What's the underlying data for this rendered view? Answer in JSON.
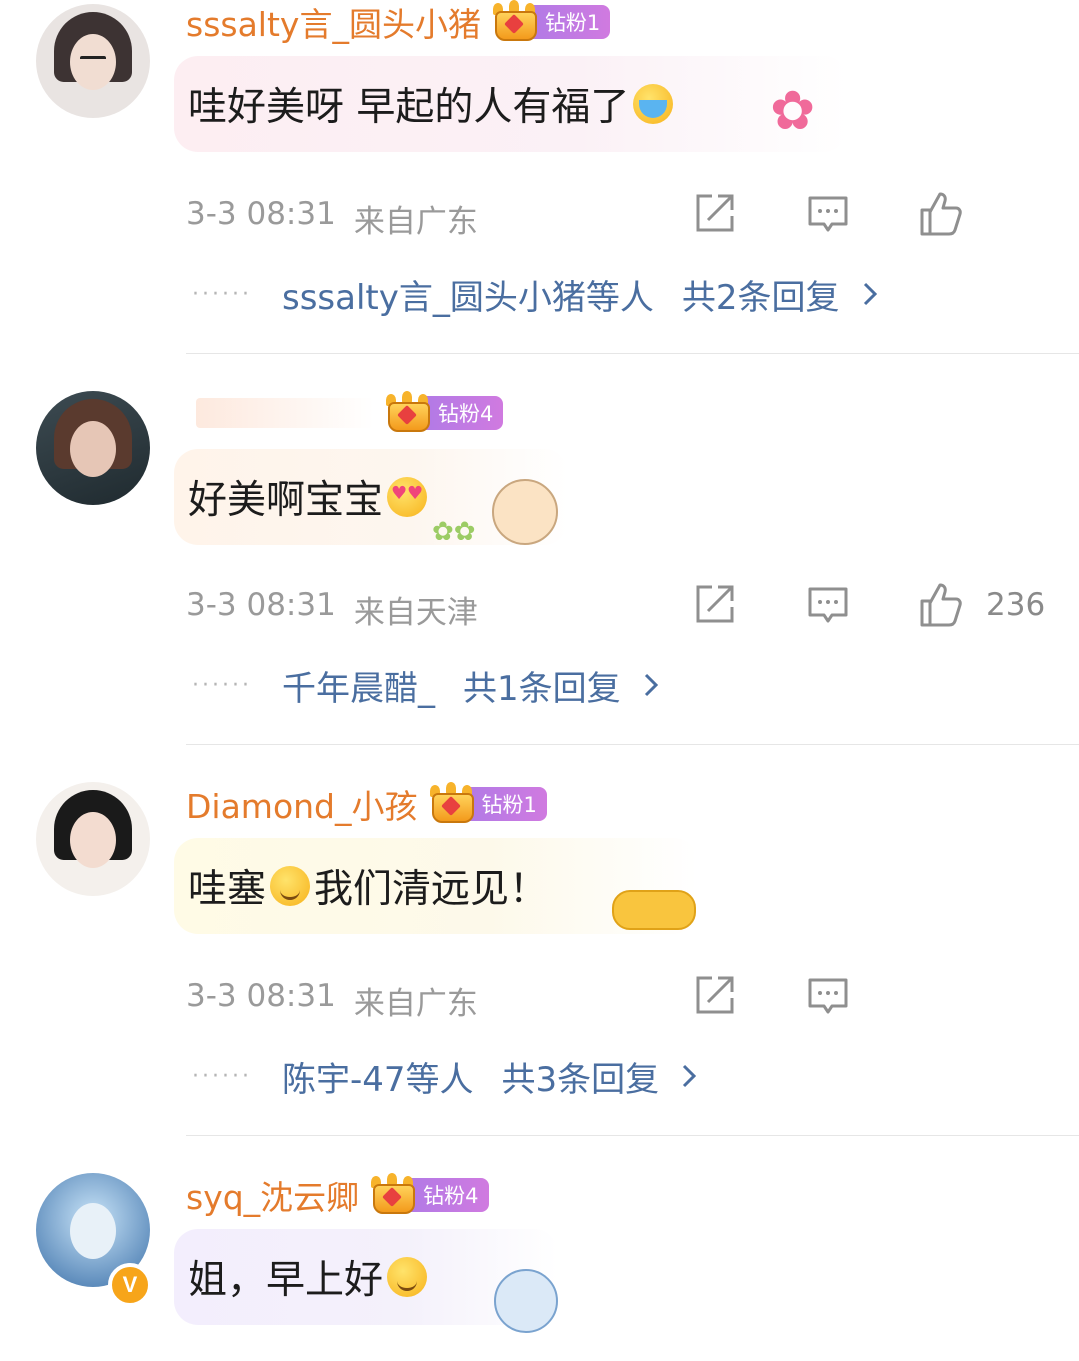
{
  "comments": [
    {
      "username": "sssalty言_圆头小猪",
      "fan_badge": "钻粉1",
      "text": "哇好美呀 早起的人有福了",
      "emoji": "loudly-crying-emoji",
      "time": "3-3 08:31",
      "location": "来自广东",
      "like_count": "",
      "reply_names": "sssalty言_圆头小猪等人",
      "reply_count": "共2条回复"
    },
    {
      "username": "",
      "fan_badge": "钻粉4",
      "text": "好美啊宝宝",
      "emoji": "heart-eyes-emoji",
      "time": "3-3 08:31",
      "location": "来自天津",
      "like_count": "236",
      "reply_names": "千年晨醋_",
      "reply_count": "共1条回复"
    },
    {
      "username": "Diamond_小孩",
      "fan_badge": "钻粉1",
      "text": "我们清远见！",
      "text_prefix": "哇塞",
      "emoji": "grinning-emoji",
      "time": "3-3 08:31",
      "location": "来自广东",
      "like_count": "",
      "reply_names": "陈宇-47等人",
      "reply_count": "共3条回复"
    },
    {
      "username": "syq_沈云卿",
      "fan_badge": "钻粉4",
      "text": "姐，早上好",
      "emoji": "hugging-emoji",
      "verified_badge": "V"
    }
  ],
  "colors": {
    "username": "#e47b2c",
    "reply_link": "#4a6ea0",
    "meta": "#9a9a9a",
    "fan_pill": "#b07ae6"
  }
}
